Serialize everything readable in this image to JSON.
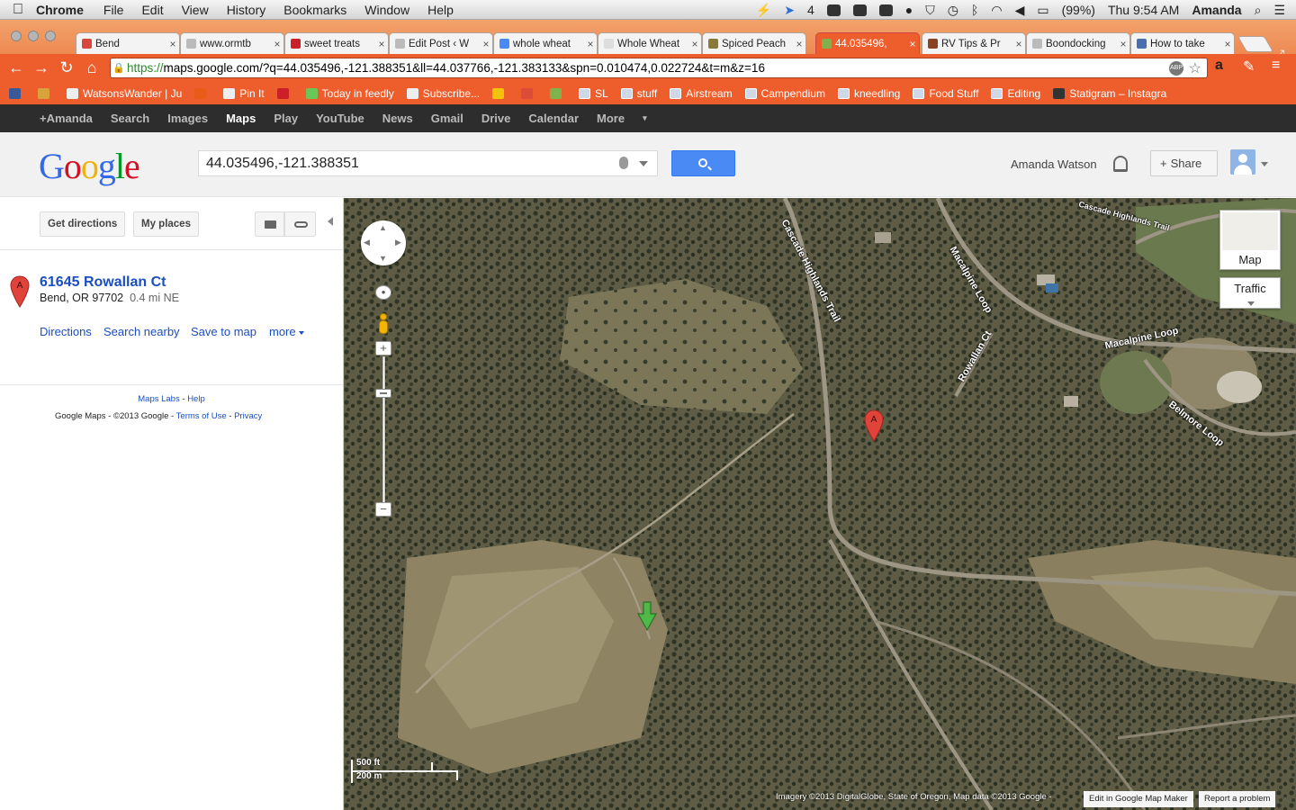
{
  "mac_menubar": {
    "app": "Chrome",
    "menus": [
      "File",
      "Edit",
      "View",
      "History",
      "Bookmarks",
      "Window",
      "Help"
    ],
    "status_badge": "4",
    "battery": "(99%)",
    "clock": "Thu 9:54 AM",
    "user": "Amanda"
  },
  "tabs": [
    {
      "label": "Bend",
      "color": "#d9463e"
    },
    {
      "label": "www.ormtb",
      "color": "#bbbbbb"
    },
    {
      "label": "sweet treats",
      "color": "#cb2027"
    },
    {
      "label": "Edit Post ‹ W",
      "color": "#bbbbbb"
    },
    {
      "label": "whole wheat",
      "color": "#4a8af4"
    },
    {
      "label": "Whole Wheat",
      "color": "#dddddd"
    },
    {
      "label": "Spiced Peach",
      "color": "#8a7a3a"
    },
    {
      "label": "44.035496,",
      "color": "#7fb24a",
      "active": true
    },
    {
      "label": "RV Tips & Pr",
      "color": "#884422"
    },
    {
      "label": "Boondocking",
      "color": "#bbbbbb"
    },
    {
      "label": "How to take",
      "color": "#4a6fb0"
    }
  ],
  "omnibox": {
    "scheme": "https://",
    "rest": "maps.google.com/?q=44.035496,-121.388351&ll=44.037766,-121.383133&spn=0.010474,0.022724&t=m&z=16"
  },
  "bookmarks": [
    {
      "label": "",
      "type": "icon",
      "color": "#3b5998"
    },
    {
      "label": "",
      "type": "icon",
      "color": "#d9a23a"
    },
    {
      "label": "WatsonsWander | Ju",
      "type": "page",
      "color": "#eeeeee"
    },
    {
      "label": "",
      "type": "icon",
      "color": "#e85c1a"
    },
    {
      "label": "Pin It",
      "type": "page",
      "color": "#eeeeee"
    },
    {
      "label": "",
      "type": "icon",
      "color": "#cb2027"
    },
    {
      "label": "Today in feedly",
      "type": "page",
      "color": "#6cc655"
    },
    {
      "label": "Subscribe...",
      "type": "page",
      "color": "#eeeeee"
    },
    {
      "label": "",
      "type": "icon",
      "color": "#f4c20d"
    },
    {
      "label": "",
      "type": "icon",
      "color": "#dd4b39"
    },
    {
      "label": "",
      "type": "icon",
      "color": "#7fb24a"
    },
    {
      "label": "SL",
      "type": "folder"
    },
    {
      "label": "stuff",
      "type": "folder"
    },
    {
      "label": "Airstream",
      "type": "folder"
    },
    {
      "label": "Campendium",
      "type": "folder"
    },
    {
      "label": "kneedling",
      "type": "folder"
    },
    {
      "label": "Food Stuff",
      "type": "folder"
    },
    {
      "label": "Editing",
      "type": "folder"
    },
    {
      "label": "Statigram – Instagra",
      "type": "page",
      "color": "#333333"
    }
  ],
  "google_bar": [
    "+Amanda",
    "Search",
    "Images",
    "Maps",
    "Play",
    "YouTube",
    "News",
    "Gmail",
    "Drive",
    "Calendar",
    "More"
  ],
  "google_bar_selected": "Maps",
  "search": {
    "value": "44.035496,-121.388351",
    "logo": "Google"
  },
  "header_user": "Amanda Watson",
  "share_label": "Share",
  "left_panel": {
    "get_directions": "Get directions",
    "my_places": "My places",
    "result": {
      "marker": "A",
      "title": "61645 Rowallan Ct",
      "city": "Bend, OR 97702",
      "distance": "0.4 mi NE"
    },
    "actions": [
      "Directions",
      "Search nearby",
      "Save to map",
      "more"
    ],
    "maps_labs": "Maps Labs",
    "help": "Help",
    "footer": {
      "brand": "Google Maps",
      "copyright": "©2013 Google",
      "terms": "Terms of Use",
      "privacy": "Privacy"
    }
  },
  "map": {
    "type_button": "Map",
    "traffic_button": "Traffic",
    "scale_ft": "500 ft",
    "scale_m": "200 m",
    "road_labels": [
      "Cascade Highlands Trail",
      "Cascade Highlands Trail",
      "Macalpine Loop",
      "Macalpine Loop",
      "Rowallan Ct",
      "Belmore Loop"
    ],
    "marker_label": "A",
    "copyright": "Imagery ©2013 DigitalGlobe, State of Oregon, Map data ©2013 Google -",
    "edit_link": "Edit in Google Map Maker",
    "report_link": "Report a problem"
  },
  "colors": {
    "chrome_accent": "#ee5d2c",
    "link": "#1a4ec1",
    "search_button": "#4a8af4",
    "marker_red": "#e0433a",
    "marker_green": "#4fb848"
  }
}
